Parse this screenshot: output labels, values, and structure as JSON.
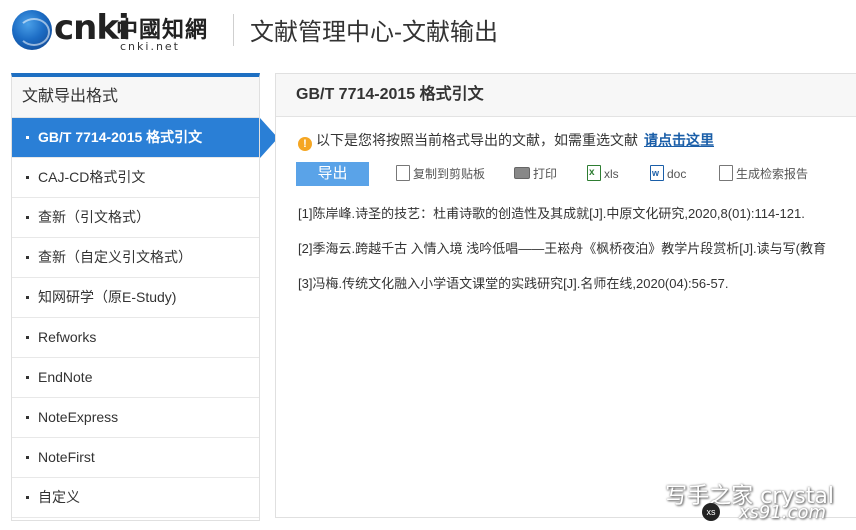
{
  "header": {
    "logo_brand": "cnki",
    "logo_cn": "中國知網",
    "logo_url": "cnki.net",
    "title": "文献管理中心-文献输出"
  },
  "sidebar": {
    "title": "文献导出格式",
    "items": [
      {
        "label": "GB/T 7714-2015 格式引文",
        "active": true
      },
      {
        "label": "CAJ-CD格式引文"
      },
      {
        "label": "查新（引文格式）"
      },
      {
        "label": "查新（自定义引文格式）"
      },
      {
        "label": "知网研学（原E-Study)"
      },
      {
        "label": "Refworks"
      },
      {
        "label": "EndNote"
      },
      {
        "label": "NoteExpress"
      },
      {
        "label": "NoteFirst"
      },
      {
        "label": "自定义"
      }
    ]
  },
  "main": {
    "title": "GB/T 7714-2015 格式引文",
    "notice_text": "以下是您将按照当前格式导出的文献，如需重选文献",
    "notice_link": "请点击这里",
    "toolbar": {
      "export": "导出",
      "copy": "复制到剪贴板",
      "print": "打印",
      "xls": "xls",
      "doc": "doc",
      "report": "生成检索报告"
    },
    "references": [
      "[1]陈岸峰.诗圣的技艺：杜甫诗歌的创造性及其成就[J].中原文化研究,2020,8(01):114-121.",
      "[2]季海云.跨越千古 入情入境 浅吟低唱——王崧舟《枫桥夜泊》教学片段赏析[J].读与写(教育",
      "[3]冯梅.传统文化融入小学语文课堂的实践研究[J].名师在线,2020(04):56-57."
    ]
  },
  "watermark": {
    "line1": "写手之家 crystal",
    "line2": "xs91.com",
    "badge": "xs"
  },
  "colors": {
    "accent": "#2a7fd6",
    "export_button": "#5aa3e8",
    "link": "#1a5ea8",
    "warning": "#f5a623"
  }
}
